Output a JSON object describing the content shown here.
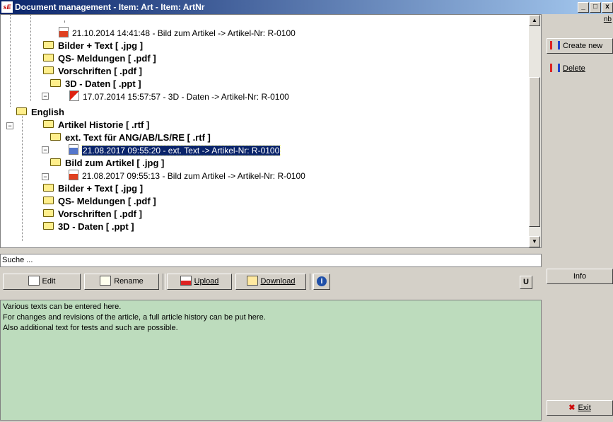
{
  "window": {
    "app_icon": "sE",
    "title": "Document management - Item: Art - Item: ArtNr",
    "buttons": [
      "_",
      "□",
      "x"
    ]
  },
  "tree": {
    "rows": [
      {
        "type": "file",
        "icon": "ppt-file-icon",
        "text": "21.10.2014 14:41:48 - Bild zum Artikel -> Artikel-Nr: R-0100"
      },
      {
        "type": "folder",
        "text": "Bilder + Text [ .jpg ]"
      },
      {
        "type": "folder",
        "text": "QS- Meldungen [ .pdf ]"
      },
      {
        "type": "folder",
        "text": "Vorschriften [ .pdf ]"
      },
      {
        "type": "folder",
        "text": "3D - Daten [ .ppt ]"
      },
      {
        "type": "file",
        "icon": "pdf-file-icon",
        "text": "17.07.2014 15:57:57 - 3D - Daten -> Artikel-Nr: R-0100"
      },
      {
        "type": "folder",
        "text": "English"
      },
      {
        "type": "folder",
        "text": "Artikel Historie [ .rtf ]"
      },
      {
        "type": "folder",
        "text": "ext. Text für ANG/AB/LS/RE [ .rtf ]"
      },
      {
        "type": "file",
        "icon": "rtf-file-icon",
        "text": "21.08.2017 09:55:20 - ext. Text -> Artikel-Nr: R-0100",
        "selected": true
      },
      {
        "type": "folder",
        "text": "Bild zum Artikel [ .jpg ]"
      },
      {
        "type": "file",
        "icon": "ppt-file-icon",
        "text": "21.08.2017 09:55:13 - Bild zum Artikel -> Artikel-Nr: R-0100"
      },
      {
        "type": "folder",
        "text": "Bilder + Text [ .jpg ]"
      },
      {
        "type": "folder",
        "text": "QS- Meldungen [ .pdf ]"
      },
      {
        "type": "folder",
        "text": "Vorschriften [ .pdf ]"
      },
      {
        "type": "folder",
        "text": "3D - Daten [ .ppt ]"
      }
    ]
  },
  "search": {
    "value": "Suche ..."
  },
  "toolbar": {
    "edit": "Edit",
    "rename": "Rename",
    "upload": "Upload",
    "download": "Download",
    "u": "U"
  },
  "note": {
    "lines": [
      "Various texts can be entered here.",
      "For changes and revisions of the article, a full article history can be put here.",
      "Also additional text for tests and such are possible."
    ]
  },
  "side": {
    "top_label": "nb",
    "create_new": "Create new",
    "delete": "Delete",
    "info": "Info",
    "exit": "Exit"
  }
}
